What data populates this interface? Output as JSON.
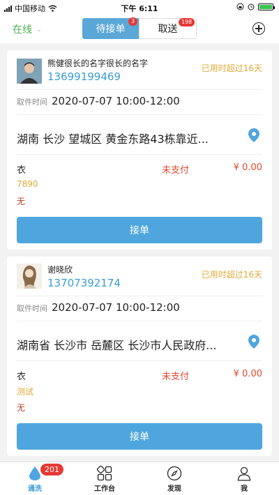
{
  "status_bar": {
    "carrier": "中国移动",
    "time": "下午 6:11"
  },
  "header": {
    "online_label": "在线",
    "tab_pending": {
      "label": "待接单",
      "badge": "3"
    },
    "tab_pickup": {
      "label": "取送",
      "badge": "198"
    }
  },
  "orders": [
    {
      "name": "熊健很长的名字很长的名字",
      "phone": "13699199469",
      "time_warning": "已用时超过16天",
      "pickup_label": "取件时间",
      "pickup_time": "2020-07-07 10:00-12:00",
      "address": "湖南 长沙 望城区 黄金东路43栋靠近...",
      "item": "衣",
      "pay_status": "未支付",
      "amount": "¥ 0.00",
      "note1": "7890",
      "note2": "无",
      "accept_label": "接单"
    },
    {
      "name": "谢晓欣",
      "phone": "13707392174",
      "time_warning": "已用时超过16天",
      "pickup_label": "取件时间",
      "pickup_time": "2020-07-07 10:00-12:00",
      "address": "湖南省 长沙市 岳麓区 长沙市人民政府...",
      "item": "衣",
      "pay_status": "未支付",
      "amount": "¥ 0.00",
      "note1": "测试",
      "note2": "无",
      "accept_label": "接单"
    }
  ],
  "tabbar": {
    "items": [
      {
        "label": "通洗",
        "icon": "drop-icon",
        "badge": "201"
      },
      {
        "label": "工作台",
        "icon": "grid-icon"
      },
      {
        "label": "发现",
        "icon": "compass-icon"
      },
      {
        "label": "我",
        "icon": "user-icon"
      }
    ]
  },
  "colors": {
    "accent": "#4fa6de",
    "online": "#4caf50",
    "warning": "#e0a83a",
    "unpaid": "#e0482f",
    "badge": "#e53935"
  }
}
